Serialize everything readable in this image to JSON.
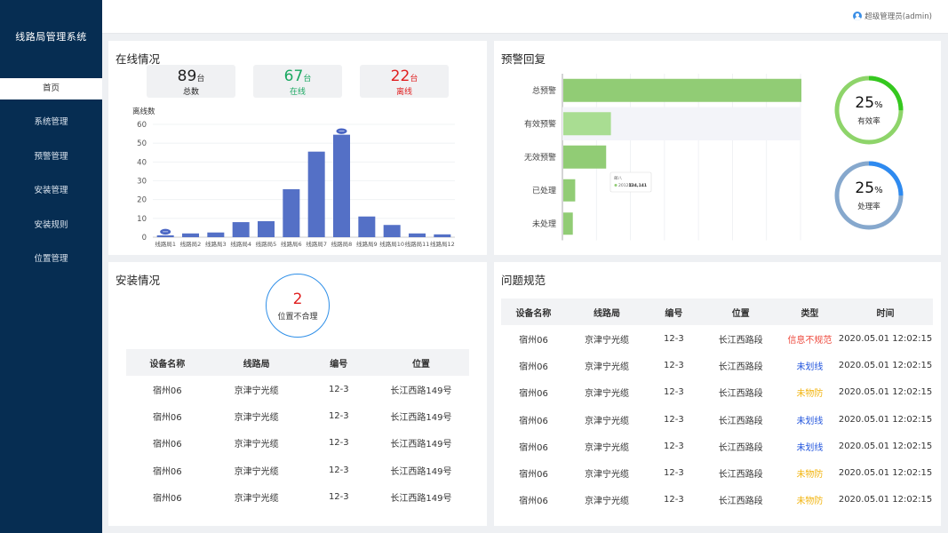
{
  "app": {
    "title": "线路局管理系统",
    "user": "超级管理员(admin)"
  },
  "menu": [
    {
      "label": "首页",
      "active": true
    },
    {
      "label": "系统管理"
    },
    {
      "label": "预警管理"
    },
    {
      "label": "安装管理"
    },
    {
      "label": "安装规则"
    },
    {
      "label": "位置管理"
    }
  ],
  "online": {
    "title": "在线情况",
    "stats": [
      {
        "num": "89",
        "unit": "台",
        "label": "总数",
        "color": "#222222"
      },
      {
        "num": "67",
        "unit": "台",
        "label": "在线",
        "color": "#1aa861"
      },
      {
        "num": "22",
        "unit": "台",
        "label": "离线",
        "color": "#e02020"
      }
    ]
  },
  "warning": {
    "title": "预警回复",
    "tooltip": {
      "title": "邮八",
      "series": "2012年",
      "value": "134,141"
    },
    "rings": [
      {
        "pct": "25",
        "unit": "%",
        "label": "有效率",
        "value": 0.25,
        "color": "#35c81f",
        "track": "#8ed46a"
      },
      {
        "pct": "25",
        "unit": "%",
        "label": "处理率",
        "value": 0.25,
        "color": "#2e8af0",
        "track": "#86a8cd"
      }
    ]
  },
  "install": {
    "title": "安装情况",
    "alert": {
      "count": "2",
      "label": "位置不合理"
    },
    "columns": [
      "设备名称",
      "线路局",
      "编号",
      "位置"
    ],
    "rows": [
      [
        "宿州06",
        "京津宁光缆",
        "12-3",
        "长江西路149号"
      ],
      [
        "宿州06",
        "京津宁光缆",
        "12-3",
        "长江西路149号"
      ],
      [
        "宿州06",
        "京津宁光缆",
        "12-3",
        "长江西路149号"
      ],
      [
        "宿州06",
        "京津宁光缆",
        "12-3",
        "长江西路149号"
      ],
      [
        "宿州06",
        "京津宁光缆",
        "12-3",
        "长江西路149号"
      ]
    ]
  },
  "problems": {
    "title": "问题规范",
    "columns": [
      "设备名称",
      "线路局",
      "编号",
      "位置",
      "类型",
      "时间"
    ],
    "rows": [
      [
        "宿州06",
        "京津宁光缆",
        "12-3",
        "长江西路段",
        "信息不规范",
        "2020.05.01 12:02:15"
      ],
      [
        "宿州06",
        "京津宁光缆",
        "12-3",
        "长江西路段",
        "未划线",
        "2020.05.01 12:02:15"
      ],
      [
        "宿州06",
        "京津宁光缆",
        "12-3",
        "长江西路段",
        "未物防",
        "2020.05.01 12:02:15"
      ],
      [
        "宿州06",
        "京津宁光缆",
        "12-3",
        "长江西路段",
        "未划线",
        "2020.05.01 12:02:15"
      ],
      [
        "宿州06",
        "京津宁光缆",
        "12-3",
        "长江西路段",
        "未划线",
        "2020.05.01 12:02:15"
      ],
      [
        "宿州06",
        "京津宁光缆",
        "12-3",
        "长江西路段",
        "未物防",
        "2020.05.01 12:02:15"
      ],
      [
        "宿州06",
        "京津宁光缆",
        "12-3",
        "长江西路段",
        "未物防",
        "2020.05.01 12:02:15"
      ]
    ],
    "type_colors": {
      "信息不规范": "#ee4b3f",
      "未划线": "#2255dd",
      "未物防": "#f2b40f"
    }
  },
  "chart_data": [
    {
      "type": "bar",
      "ylabel": "离线数",
      "ylim": [
        0,
        60
      ],
      "yticks": [
        0,
        10,
        20,
        30,
        40,
        50,
        60
      ],
      "categories": [
        "线路局1",
        "线路局2",
        "线路局3",
        "线路局4",
        "线路局5",
        "线路局6",
        "线路局7",
        "线路局8",
        "线路局9",
        "线路局10",
        "线路局11",
        "线路局12"
      ],
      "values": [
        1,
        2,
        2.5,
        8,
        8.5,
        25.5,
        45.5,
        54.5,
        11,
        6.5,
        2,
        1.5
      ],
      "color": "#5470c6",
      "markers": [
        "线路局1",
        "线路局8"
      ]
    },
    {
      "type": "bar",
      "orientation": "horizontal",
      "categories": [
        "总预警",
        "有效预警",
        "无效预警",
        "已处理",
        "未处理"
      ],
      "values": [
        100,
        20,
        18,
        5,
        4
      ],
      "colors": [
        "#91cc75",
        "#a9dd92",
        "#91cc75",
        "#91cc75",
        "#91cc75"
      ],
      "highlight": "有效预警"
    }
  ]
}
